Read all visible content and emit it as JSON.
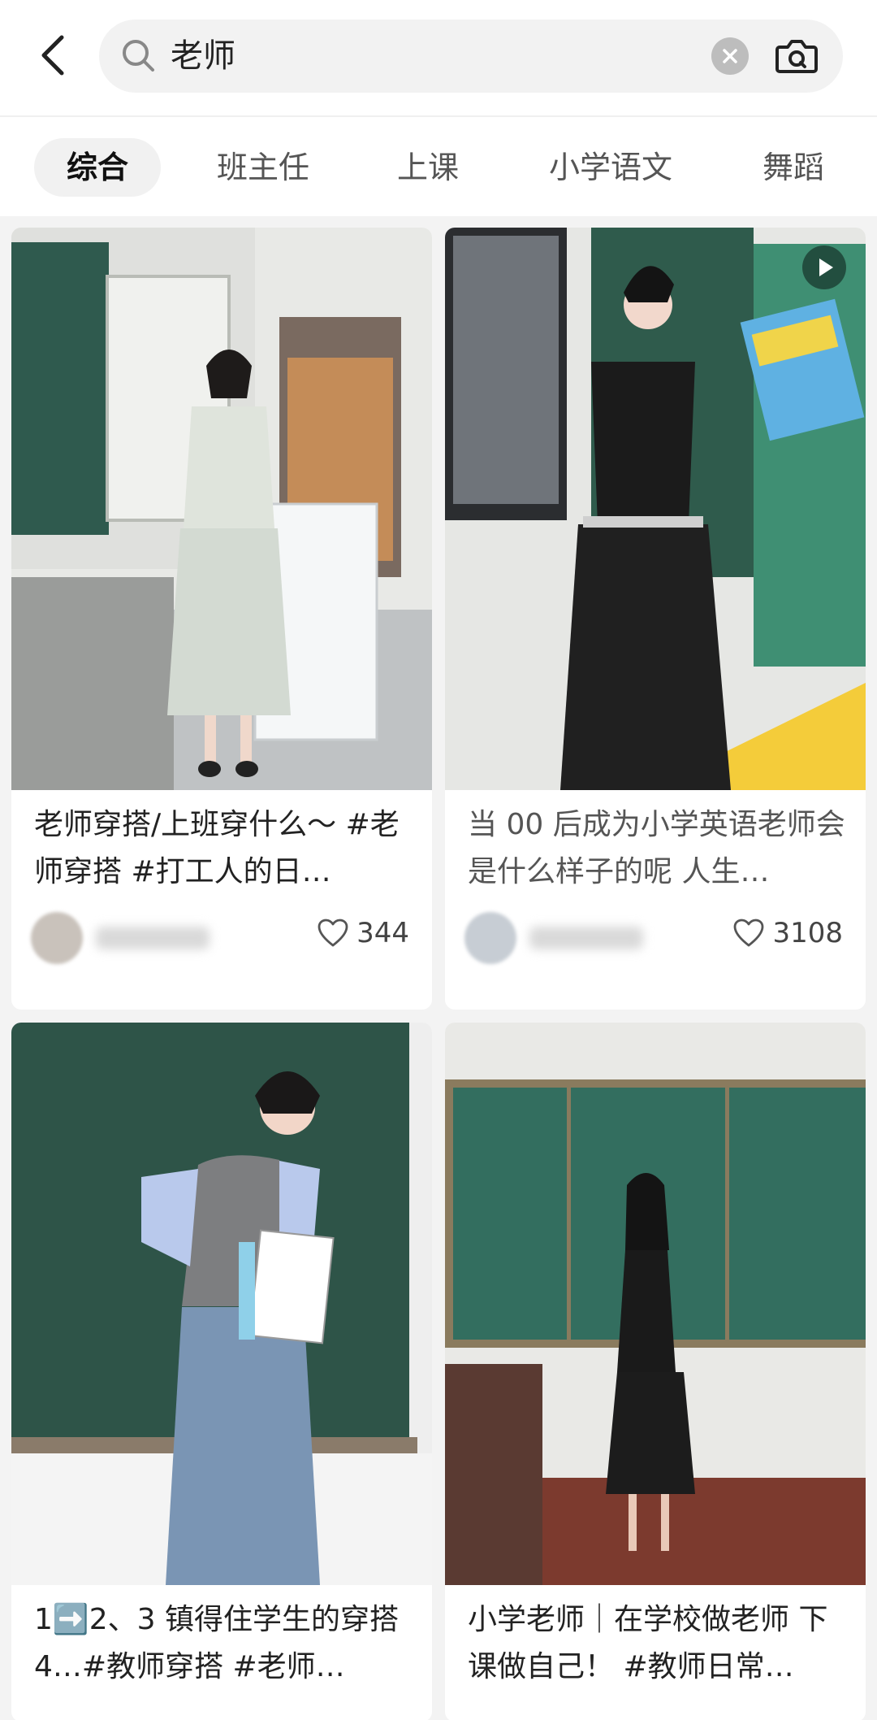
{
  "search": {
    "query": "老师"
  },
  "tabs": [
    {
      "label": "综合",
      "active": true
    },
    {
      "label": "班主任"
    },
    {
      "label": "上课"
    },
    {
      "label": "小学语文"
    },
    {
      "label": "舞蹈"
    }
  ],
  "cards": [
    {
      "title": "老师穿搭/上班穿什么～ #老师穿搭 #打工人的日…",
      "likes": "344"
    },
    {
      "title": "当 00 后成为小学英语老师会是什么样子的呢 人生…",
      "likes": "3108"
    },
    {
      "title": "1➡️2、3 镇得住学生的穿搭 4…#教师穿搭 #老师…"
    },
    {
      "title": "小学老师｜在学校做老师 下课做自己！ #教师日常…"
    }
  ],
  "colors": {
    "accent": "#222222",
    "tab_active_bg": "#f1f1f1",
    "search_bg": "#f2f2f2"
  },
  "icons": [
    "back-arrow-icon",
    "search-icon",
    "clear-icon",
    "camera-search-icon",
    "heart-icon",
    "play-icon"
  ]
}
